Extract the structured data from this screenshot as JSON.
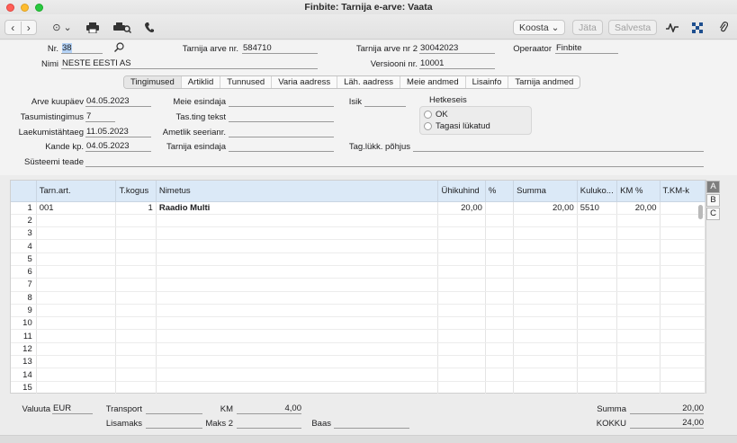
{
  "window": {
    "title": "Finbite: Tarnija e-arve: Vaata"
  },
  "toolbar": {
    "back": "‹",
    "forward": "›",
    "more": "⊙ ⌄",
    "actions_label": "Koosta ⌄",
    "cancel_label": "Jäta",
    "save_label": "Salvesta"
  },
  "header": {
    "nr_label": "Nr.",
    "nr_value": "38",
    "supplier_invoice_label": "Tarnija arve nr.",
    "supplier_invoice_value": "584710",
    "supplier_invoice2_label": "Tarnija arve nr 2",
    "supplier_invoice2_value": "30042023",
    "operator_label": "Operaator",
    "operator_value": "Finbite",
    "name_label": "Nimi",
    "name_value": "NESTE EESTI AS",
    "version_label": "Versiooni nr.",
    "version_value": "10001"
  },
  "tabs": [
    "Tingimused",
    "Artiklid",
    "Tunnused",
    "Varia aadress",
    "Läh. aadress",
    "Meie andmed",
    "Lisainfo",
    "Tarnija andmed"
  ],
  "terms": {
    "invoice_date_label": "Arve kuupäev",
    "invoice_date_value": "04.05.2023",
    "our_rep_label": "Meie esindaja",
    "our_rep_value": "",
    "person_label": "Isik",
    "person_value": "",
    "payment_terms_label": "Tasumistingimus",
    "payment_terms_value": "7",
    "payment_text_label": "Tas.ting tekst",
    "payment_text_value": "",
    "due_date_label": "Laekumistähtaeg",
    "due_date_value": "11.05.2023",
    "official_serial_label": "Ametlik seerianr.",
    "official_serial_value": "",
    "entry_date_label": "Kande kp.",
    "entry_date_value": "04.05.2023",
    "supplier_rep_label": "Tarnija esindaja",
    "supplier_rep_value": "",
    "rejection_reason_label": "Tag.lükk. põhjus",
    "rejection_reason_value": "",
    "system_msg_label": "Süsteemi teade",
    "system_msg_value": "",
    "status_title": "Hetkeseis",
    "status_ok": "OK",
    "status_rejected": "Tagasi lükatud"
  },
  "grid": {
    "columns": [
      "",
      "Tarn.art.",
      "T.kogus",
      "Nimetus",
      "Ühikuhind",
      "%",
      "Summa",
      "Kuluko...",
      "KM %",
      "T.KM-k"
    ],
    "rows": [
      [
        "1",
        "001",
        "1",
        "Raadio Multi",
        "20,00",
        "",
        "20,00",
        "5510",
        "20,00",
        ""
      ],
      [
        "2",
        "",
        "",
        "",
        "",
        "",
        "",
        "",
        "",
        ""
      ],
      [
        "3",
        "",
        "",
        "",
        "",
        "",
        "",
        "",
        "",
        ""
      ],
      [
        "4",
        "",
        "",
        "",
        "",
        "",
        "",
        "",
        "",
        ""
      ],
      [
        "5",
        "",
        "",
        "",
        "",
        "",
        "",
        "",
        "",
        ""
      ],
      [
        "6",
        "",
        "",
        "",
        "",
        "",
        "",
        "",
        "",
        ""
      ],
      [
        "7",
        "",
        "",
        "",
        "",
        "",
        "",
        "",
        "",
        ""
      ],
      [
        "8",
        "",
        "",
        "",
        "",
        "",
        "",
        "",
        "",
        ""
      ],
      [
        "9",
        "",
        "",
        "",
        "",
        "",
        "",
        "",
        "",
        ""
      ],
      [
        "10",
        "",
        "",
        "",
        "",
        "",
        "",
        "",
        "",
        ""
      ],
      [
        "11",
        "",
        "",
        "",
        "",
        "",
        "",
        "",
        "",
        ""
      ],
      [
        "12",
        "",
        "",
        "",
        "",
        "",
        "",
        "",
        "",
        ""
      ],
      [
        "13",
        "",
        "",
        "",
        "",
        "",
        "",
        "",
        "",
        ""
      ],
      [
        "14",
        "",
        "",
        "",
        "",
        "",
        "",
        "",
        "",
        ""
      ],
      [
        "15",
        "",
        "",
        "",
        "",
        "",
        "",
        "",
        "",
        ""
      ]
    ],
    "side_buttons": [
      "A",
      "B",
      "C"
    ]
  },
  "footer": {
    "currency_label": "Valuuta",
    "currency_value": "EUR",
    "transport_label": "Transport",
    "transport_value": "",
    "vat_label": "KM",
    "vat_value": "4,00",
    "sum_label": "Summa",
    "sum_value": "20,00",
    "surcharge_label": "Lisamaks",
    "surcharge_value": "",
    "tax2_label": "Maks 2",
    "tax2_value": "",
    "base_label": "Baas",
    "base_value": "",
    "total_label": "KOKKU",
    "total_value": "24,00"
  }
}
